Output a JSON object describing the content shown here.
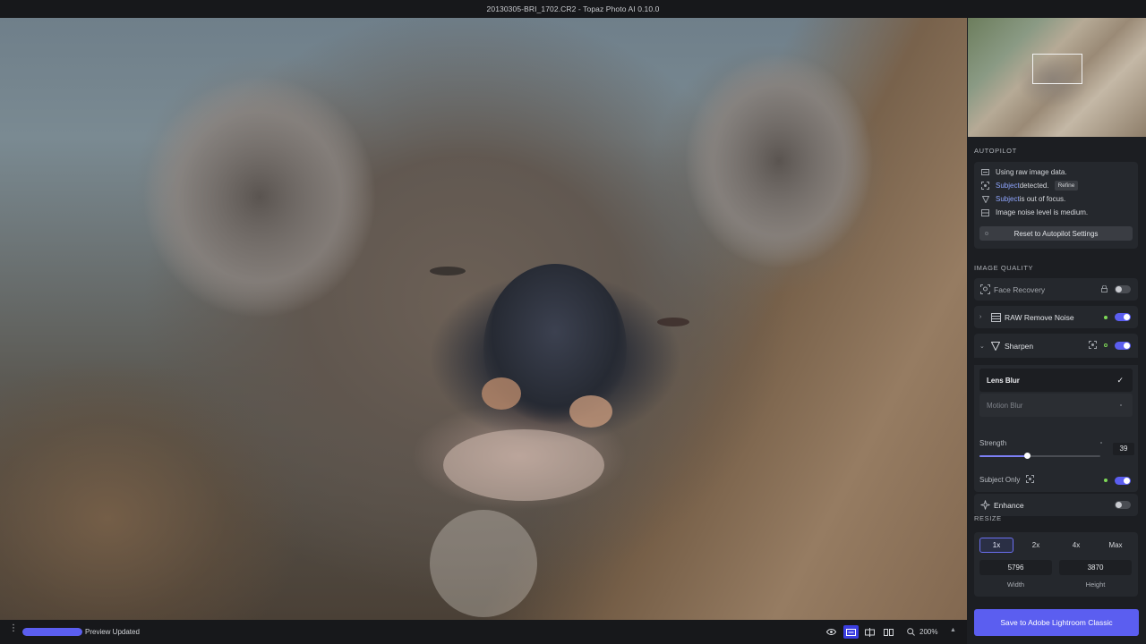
{
  "window": {
    "title": "20130305-BRI_1702.CR2 - Topaz Photo AI 0.10.0"
  },
  "autopilot": {
    "heading": "AUTOPILOT",
    "raw_text": "Using raw image data.",
    "subject_word": "Subject",
    "detected_text": " detected.",
    "refine_label": "Refine",
    "focus_text": " is out of focus.",
    "noise_text": "Image noise level is medium.",
    "reset_label": "Reset to Autopilot Settings"
  },
  "image_quality": {
    "heading": "IMAGE QUALITY",
    "face_recovery": {
      "label": "Face Recovery",
      "enabled": false
    },
    "raw_remove_noise": {
      "label": "RAW Remove Noise",
      "enabled": true
    },
    "sharpen": {
      "label": "Sharpen",
      "enabled": true,
      "modes": [
        {
          "label": "Lens Blur",
          "selected": true
        },
        {
          "label": "Motion Blur",
          "selected": false
        }
      ],
      "strength_label": "Strength",
      "strength_value": "39",
      "strength_fraction": 0.39,
      "subject_only_label": "Subject Only",
      "subject_only_enabled": true
    },
    "enhance": {
      "label": "Enhance",
      "enabled": false
    }
  },
  "resize": {
    "heading": "RESIZE",
    "scales": [
      "1x",
      "2x",
      "4x",
      "Max"
    ],
    "selected_scale": "1x",
    "width_value": "5796",
    "height_value": "3870",
    "width_label": "Width",
    "height_label": "Height"
  },
  "save_button": {
    "label": "Save to Adobe Lightroom Classic"
  },
  "bottom_bar": {
    "status": "Preview Updated",
    "progress_fraction": 1.0,
    "zoom": "200%"
  },
  "colors": {
    "accent": "#5b5ef0",
    "active_dot": "#7ed957",
    "highlight_text": "#8fa6ff"
  },
  "icons": {
    "menu": "kebab-menu-icon",
    "eye": "eye-icon",
    "single_view": "single-view-icon",
    "split_view": "split-view-icon",
    "side_by_side": "side-by-side-icon",
    "zoom": "zoom-icon"
  }
}
